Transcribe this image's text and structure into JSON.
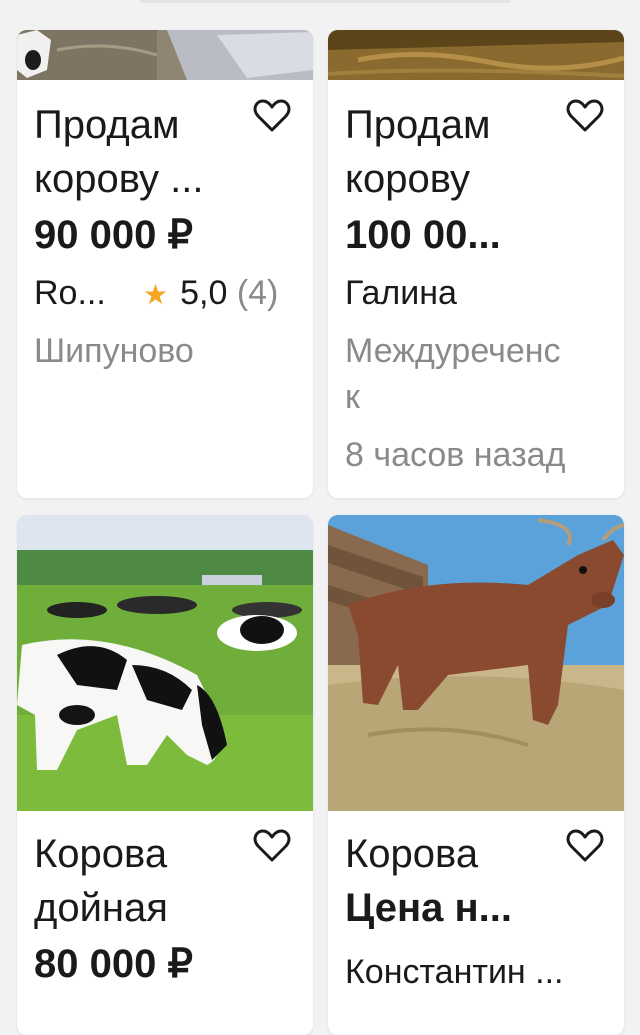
{
  "listings": [
    {
      "title_lines": [
        "Продам",
        "корову ..."
      ],
      "price": "90 000 ₽",
      "seller": "Ro...",
      "rating_value": "5,0",
      "rating_count": "(4)",
      "location_lines": [
        "Шипуново"
      ],
      "time": ""
    },
    {
      "title_lines": [
        "Продам",
        "корову"
      ],
      "price": "100 00...",
      "seller": "Галина",
      "location_lines": [
        "Междуреченс",
        "к"
      ],
      "time": "8 часов назад"
    },
    {
      "title_lines": [
        "Корова",
        "дойная"
      ],
      "price": "80 000 ₽"
    },
    {
      "title_lines": [
        "Корова",
        "Цена н..."
      ],
      "seller": "Константин ..."
    }
  ],
  "icons": {
    "favorite": "heart-outline-icon",
    "rating": "star-icon"
  },
  "colors": {
    "star": "#f5a623",
    "muted_text": "#8a8a8a"
  }
}
